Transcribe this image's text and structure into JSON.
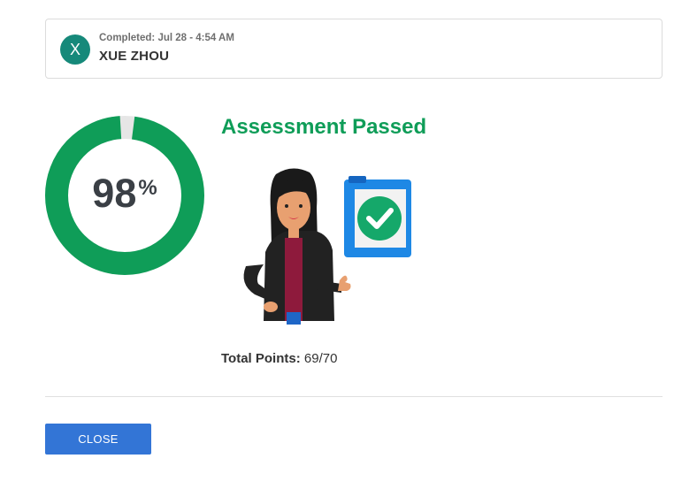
{
  "submission": {
    "avatar_initial": "X",
    "completed_label": "Completed: Jul 28 - 4:54 AM",
    "user_name": "XUE ZHOU"
  },
  "score": {
    "value": "98",
    "unit": "%",
    "fraction": 0.98
  },
  "result": {
    "title": "Assessment Passed",
    "total_points_label": "Total Points:",
    "total_points_value": "69/70"
  },
  "actions": {
    "close_label": "CLOSE"
  },
  "colors": {
    "avatar": "#16897a",
    "pass_green": "#0f9d58",
    "ring_track": "#e6e6e6",
    "button_blue": "#3375d6"
  }
}
